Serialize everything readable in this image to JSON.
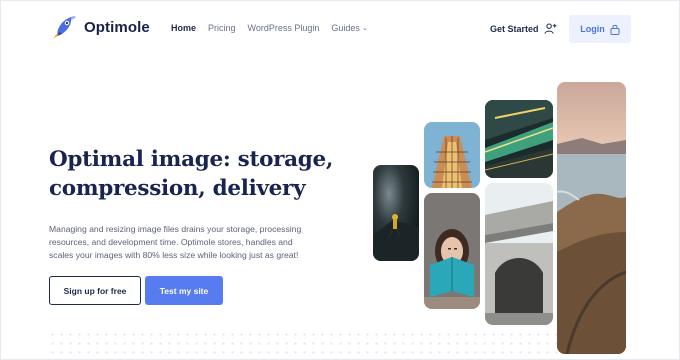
{
  "brand": {
    "name": "Optimole"
  },
  "nav": {
    "items": [
      {
        "label": "Home"
      },
      {
        "label": "Pricing"
      },
      {
        "label": "WordPress Plugin"
      },
      {
        "label": "Guides"
      }
    ]
  },
  "header": {
    "get_started": "Get Started",
    "login": "Login"
  },
  "hero": {
    "headline_line1": "Optimal image: storage,",
    "headline_line2": "compression, delivery",
    "description": "Managing and resizing image files drains your storage, processing resources, and development time. Optimole stores, handles and scales your images with 80% less size while looking just as great!",
    "cta_primary": "Sign up for free",
    "cta_secondary": "Test my site"
  },
  "colors": {
    "accent": "#577cf0",
    "navy": "#1a2451",
    "login_bg": "#edf1fd"
  },
  "icons": {
    "logo": "rocket-mascot-icon",
    "get_started": "user-plus-icon",
    "login": "lock-icon",
    "guides": "chevron-down-icon"
  }
}
